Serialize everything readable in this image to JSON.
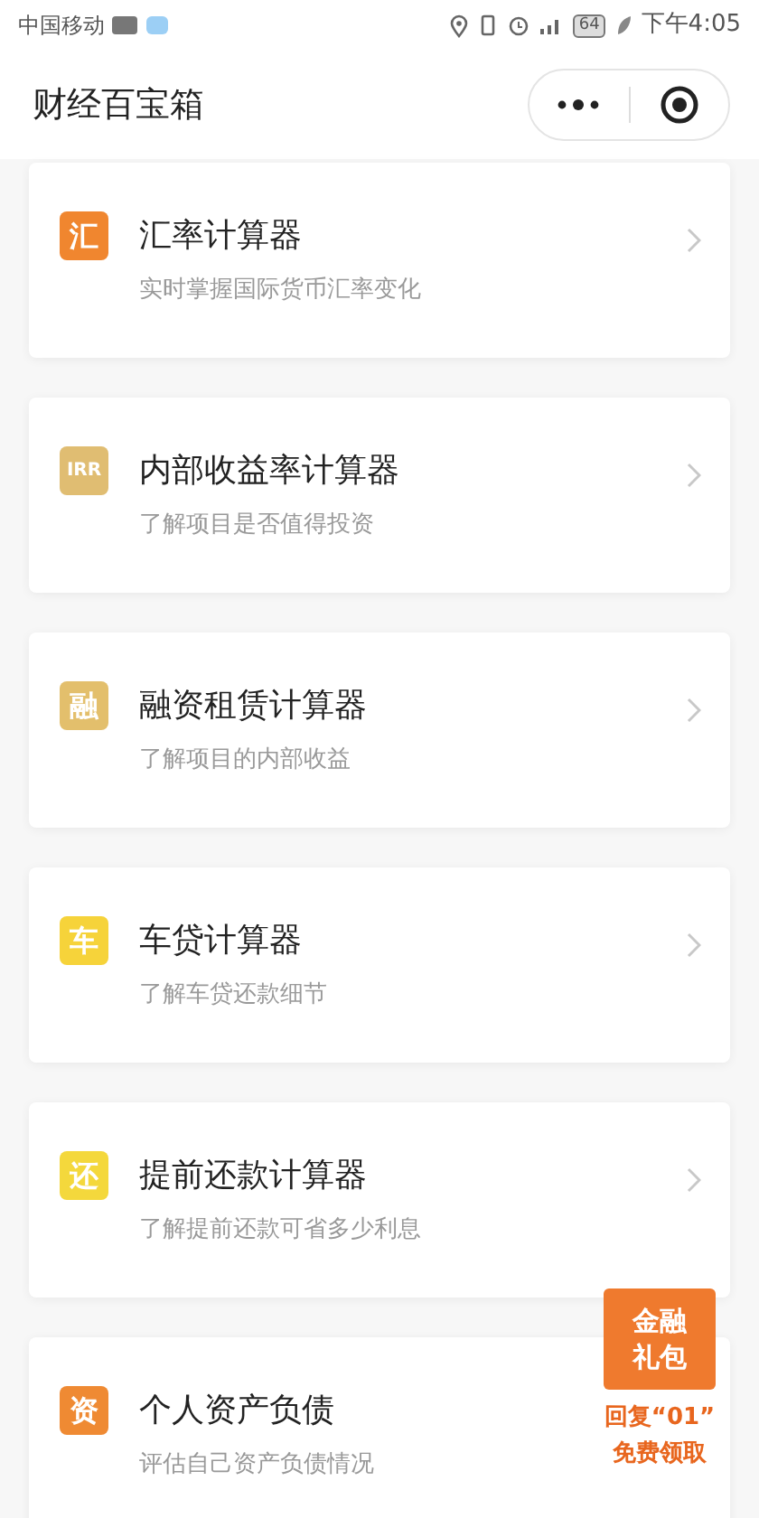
{
  "status_bar": {
    "carrier": "中国移动",
    "battery": "64",
    "time": "下午4:05"
  },
  "header": {
    "title": "财经百宝箱"
  },
  "tools": [
    {
      "icon_text": "汇",
      "color": "#f0862f",
      "title": "汇率计算器",
      "subtitle": "实时掌握国际货币汇率变化"
    },
    {
      "icon_text": "IRR",
      "color": "#e0bd72",
      "title": "内部收益率计算器",
      "subtitle": "了解项目是否值得投资"
    },
    {
      "icon_text": "融",
      "color": "#e3bf6c",
      "title": "融资租赁计算器",
      "subtitle": "了解项目的内部收益"
    },
    {
      "icon_text": "车",
      "color": "#f6d33a",
      "title": "车贷计算器",
      "subtitle": "了解车贷还款细节"
    },
    {
      "icon_text": "还",
      "color": "#f4d83c",
      "title": "提前还款计算器",
      "subtitle": "了解提前还款可省多少利息"
    },
    {
      "icon_text": "资",
      "color": "#ef8a33",
      "title": "个人资产负债",
      "subtitle": "评估自己资产负债情况"
    }
  ],
  "gift_badge": {
    "lines": [
      "金融",
      "礼包"
    ],
    "caption": [
      "回复“01”",
      "免费领取"
    ]
  }
}
